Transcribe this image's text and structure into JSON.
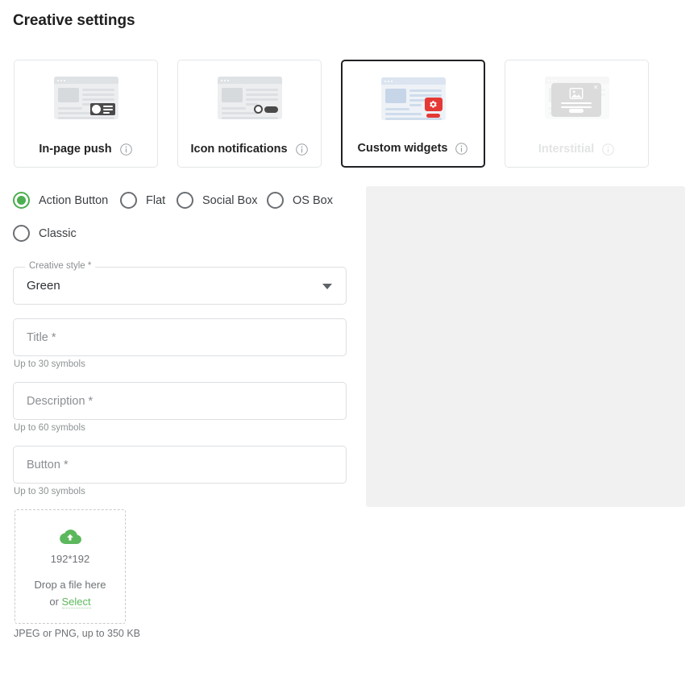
{
  "page": {
    "title": "Creative settings"
  },
  "format_cards": [
    {
      "label": "In-page push",
      "icon": "in-page-push-thumb",
      "info_icon": "info-icon",
      "selected": false,
      "disabled": false
    },
    {
      "label": "Icon notifications",
      "icon": "icon-notifications-thumb",
      "info_icon": "info-icon",
      "selected": false,
      "disabled": false
    },
    {
      "label": "Custom widgets",
      "icon": "custom-widgets-thumb",
      "info_icon": "info-icon",
      "selected": true,
      "disabled": false
    },
    {
      "label": "Interstitial",
      "icon": "interstitial-thumb",
      "info_icon": "info-icon",
      "selected": false,
      "disabled": true
    }
  ],
  "style_radios": {
    "selected": "Action Button",
    "row1": [
      {
        "label": "Action Button",
        "selected": true
      },
      {
        "label": "Flat",
        "selected": false
      },
      {
        "label": "Social Box",
        "selected": false
      },
      {
        "label": "OS Box",
        "selected": false
      }
    ],
    "row2": [
      {
        "label": "Classic",
        "selected": false
      }
    ]
  },
  "creative_style": {
    "label": "Creative style *",
    "value": "Green",
    "caret_icon": "chevron-down-icon"
  },
  "fields": [
    {
      "placeholder": "Title *",
      "value": "",
      "helper": "Up to 30 symbols"
    },
    {
      "placeholder": "Description *",
      "value": "",
      "helper": "Up to 60 symbols"
    },
    {
      "placeholder": "Button *",
      "value": "",
      "helper": "Up to 30 symbols"
    }
  ],
  "uploader": {
    "cloud_icon": "cloud-upload-icon",
    "size_hint": "192*192",
    "drop_text": "Drop a file here",
    "or_text": "or ",
    "select_link": "Select",
    "note": "JPEG or PNG, up to 350 KB"
  },
  "preview": {
    "empty": true
  },
  "colors": {
    "accent_green": "#4caf50",
    "link_green": "#5cb85c",
    "badge_red": "#e53935",
    "selected_border": "#202124",
    "preview_bg": "#f1f1f1",
    "text": "#202124",
    "muted_text": "#8b8f93"
  }
}
